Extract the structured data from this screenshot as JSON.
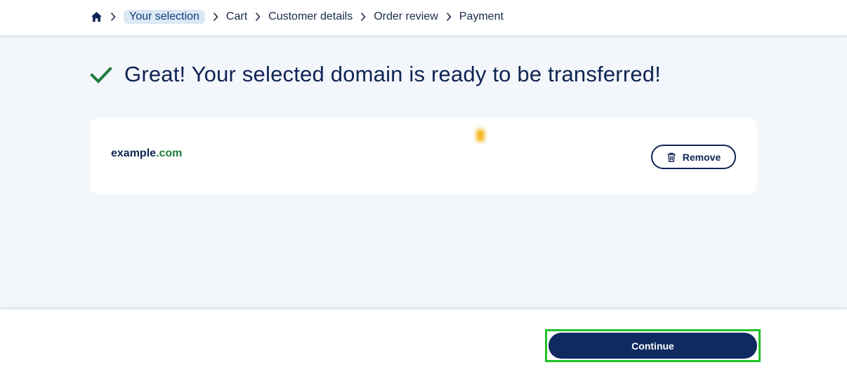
{
  "breadcrumb": {
    "home_icon": "home-icon",
    "items": [
      "Your selection",
      "Cart",
      "Customer details",
      "Order review",
      "Payment"
    ]
  },
  "headline": {
    "icon": "check-icon",
    "text": "Great! Your selected domain is ready to be transferred!"
  },
  "domain": {
    "name": "example",
    "tld": ".com",
    "remove_label": "Remove"
  },
  "footer": {
    "continue_label": "Continue"
  },
  "colors": {
    "primary": "#0e2a5e",
    "success": "#1f7a3a",
    "highlight": "#22c22a",
    "background": "#f3f6fa"
  }
}
